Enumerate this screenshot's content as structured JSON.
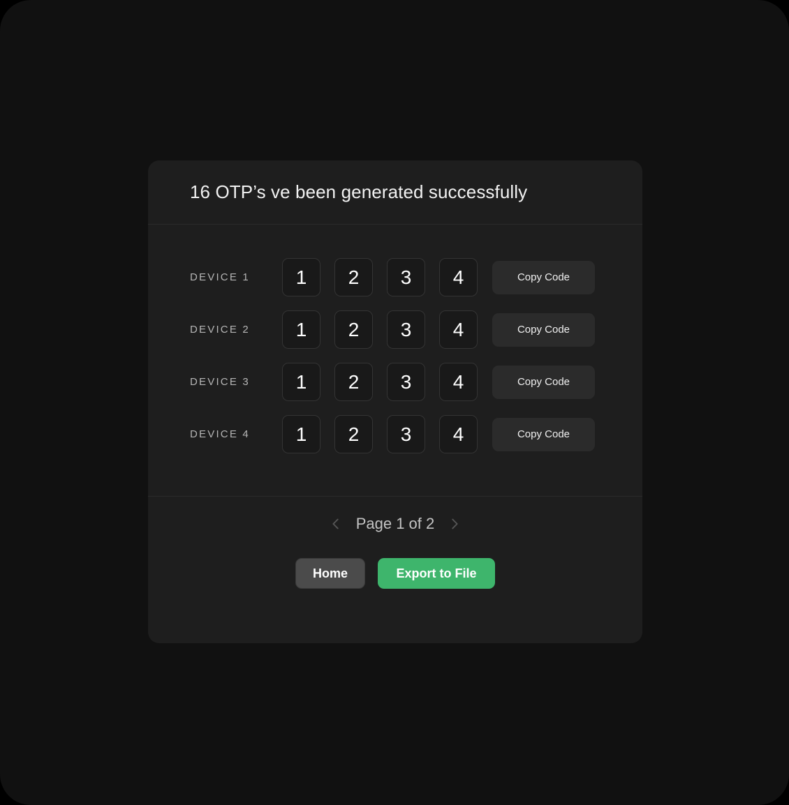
{
  "card": {
    "title": "16 OTP’s ve been generated successfully",
    "devices": [
      {
        "label": "DEVICE 1",
        "digits": [
          "1",
          "2",
          "3",
          "4"
        ],
        "copy_label": "Copy Code"
      },
      {
        "label": "DEVICE 2",
        "digits": [
          "1",
          "2",
          "3",
          "4"
        ],
        "copy_label": "Copy Code"
      },
      {
        "label": "DEVICE 3",
        "digits": [
          "1",
          "2",
          "3",
          "4"
        ],
        "copy_label": "Copy Code"
      },
      {
        "label": "DEVICE 4",
        "digits": [
          "1",
          "2",
          "3",
          "4"
        ],
        "copy_label": "Copy Code"
      }
    ],
    "pagination": {
      "text": "Page 1 of 2",
      "prev_icon": "chevron-left-icon",
      "next_icon": "chevron-right-icon"
    },
    "actions": {
      "home_label": "Home",
      "export_label": "Export to File"
    }
  },
  "colors": {
    "page_bg": "#111111",
    "card_bg": "#1e1e1e",
    "divider": "#2b2b2b",
    "digit_box_bg": "#191919",
    "digit_box_border": "#343434",
    "copy_btn_bg": "#2b2b2b",
    "accent_green": "#3eb56c",
    "home_btn_bg": "#4b4b4b",
    "label_text": "#b6b6b6",
    "pager_text": "#c3c3c3",
    "chevron": "#565656"
  }
}
